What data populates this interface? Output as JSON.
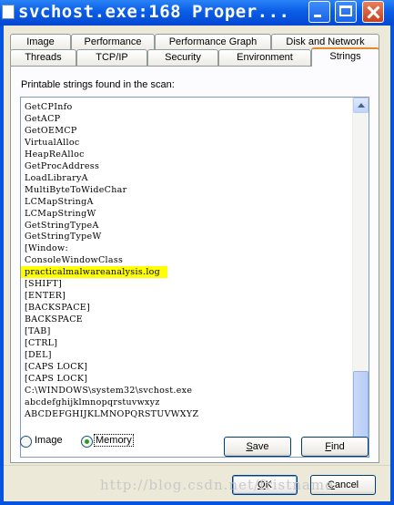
{
  "window": {
    "title": "svchost.exe:168 Proper..."
  },
  "tabs_row1": [
    "Image",
    "Performance",
    "Performance Graph",
    "Disk and Network"
  ],
  "tabs_row2": [
    "Threads",
    "TCP/IP",
    "Security",
    "Environment",
    "Strings"
  ],
  "active_tab": "Strings",
  "panel": {
    "label": "Printable strings found in the scan:"
  },
  "strings": [
    "GetCPInfo",
    "GetACP",
    "GetOEMCP",
    "VirtualAlloc",
    "HeapReAlloc",
    "GetProcAddress",
    "LoadLibraryA",
    "MultiByteToWideChar",
    "LCMapStringA",
    "LCMapStringW",
    "GetStringTypeA",
    "GetStringTypeW",
    "[Window:",
    "ConsoleWindowClass",
    "practicalmalwareanalysis.log",
    "[SHIFT]",
    "[ENTER]",
    "[BACKSPACE]",
    "BACKSPACE",
    "[TAB]",
    "[CTRL]",
    "[DEL]",
    "[CAPS LOCK]",
    "[CAPS LOCK]",
    "C:\\WINDOWS\\system32\\svchost.exe",
    "abcdefghijklmnopqrstuvwxyz",
    "ABCDEFGHIJKLMNOPQRSTUVWXYZ"
  ],
  "highlighted_string": "practicalmalwareanalysis.log",
  "highlight_color": "#ffff00",
  "scan_source": {
    "options": [
      "Image",
      "Memory"
    ],
    "selected": "Memory"
  },
  "buttons": {
    "save_prefix": "",
    "save_mnemonic": "S",
    "save_rest": "ave",
    "find_prefix": "",
    "find_mnemonic": "F",
    "find_rest": "ind",
    "ok_prefix": "",
    "ok_mnemonic": "O",
    "ok_rest": "K",
    "cancel_prefix": "",
    "cancel_mnemonic": "C",
    "cancel_rest": "ancel"
  },
  "watermark": "http://blog.csdn.net/fristname"
}
